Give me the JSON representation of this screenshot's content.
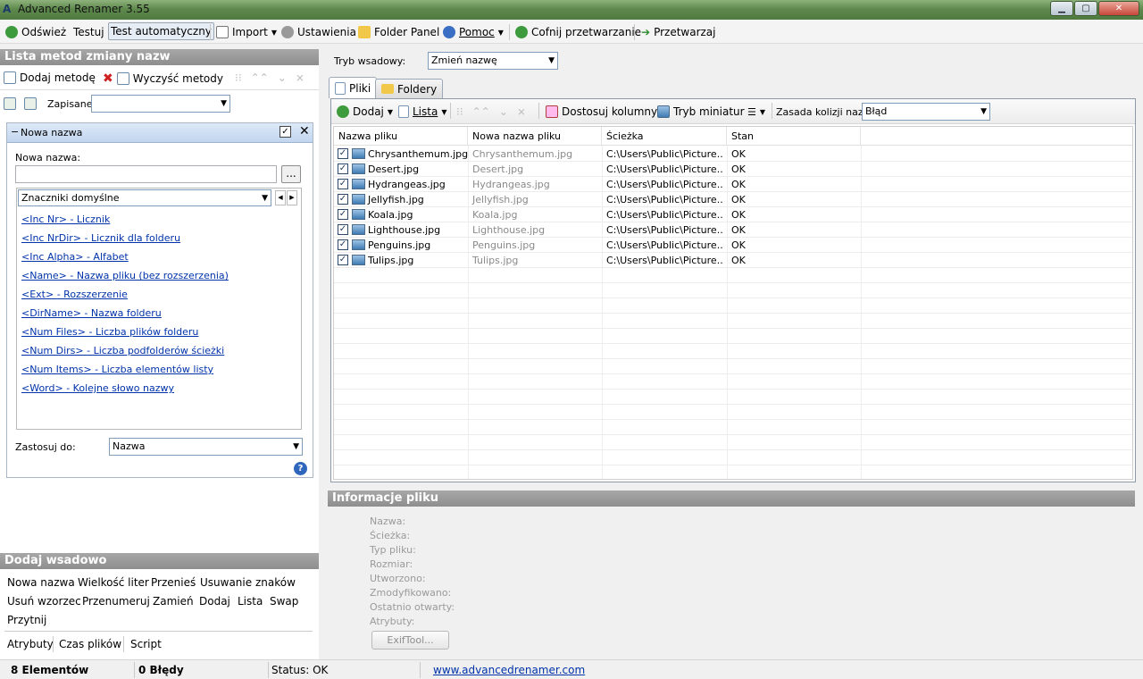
{
  "window": {
    "title": "Advanced Renamer 3.55"
  },
  "toolbar": {
    "refresh": "Odśwież",
    "test": "Testuj",
    "auto_test": "Test automatyczny",
    "import": "Import",
    "settings": "Ustawienia",
    "folder_panel": "Folder Panel",
    "help": "Pomoc",
    "undo": "Cofnij przetwarzanie",
    "process": "Przetwarzaj"
  },
  "left": {
    "header": "Lista metod zmiany nazw",
    "add_method": "Dodaj metodę",
    "clear_methods": "Wyczyść metody",
    "saved_label": "Zapisane:",
    "saved_value": "",
    "method": {
      "title": "Nowa nazwa",
      "field_label": "Nowa nazwa:",
      "field_value": "",
      "browse": "...",
      "tags_select": "Znaczniki domyślne",
      "tags": [
        "<Inc Nr> - Licznik",
        "<Inc NrDir> - Licznik dla folderu",
        "<Inc Alpha> - Alfabet",
        "<Name> - Nazwa pliku (bez rozszerzenia)",
        "<Ext> - Rozszerzenie",
        "<DirName> - Nazwa folderu",
        "<Num Files> - Liczba plików folderu",
        "<Num Dirs> - Liczba podfolderów ścieżki",
        "<Num Items> - Liczba elementów listy",
        "<Word> - Kolejne słowo nazwy"
      ],
      "apply_label": "Zastosuj do:",
      "apply_value": "Nazwa"
    },
    "batch": {
      "header": "Dodaj wsadowo",
      "row1": [
        "Nowa nazwa",
        "Wielkość liter",
        "Przenieś",
        "Usuwanie znaków"
      ],
      "row2": [
        "Usuń wzorzec",
        "Przenumeruj",
        "Zamień",
        "Dodaj",
        "Lista",
        "Swap"
      ],
      "row3": [
        "Przytnij"
      ],
      "row4": [
        "Atrybuty",
        "Czas plików",
        "Script"
      ]
    }
  },
  "right": {
    "mode_label": "Tryb wsadowy:",
    "mode_value": "Zmień nazwę",
    "tabs": [
      "Pliki",
      "Foldery"
    ],
    "list_toolbar": {
      "add": "Dodaj",
      "list": "Lista",
      "fit_columns": "Dostosuj kolumny",
      "thumb_mode": "Tryb miniatur",
      "collision_label": "Zasada kolizji nazw:",
      "collision_value": "Błąd"
    },
    "columns": [
      "Nazwa pliku",
      "Nowa nazwa pliku",
      "Ścieżka",
      "Stan"
    ],
    "files": [
      {
        "name": "Chrysanthemum.jpg",
        "new": "Chrysanthemum.jpg",
        "path": "C:\\Users\\Public\\Picture...",
        "state": "OK"
      },
      {
        "name": "Desert.jpg",
        "new": "Desert.jpg",
        "path": "C:\\Users\\Public\\Picture...",
        "state": "OK"
      },
      {
        "name": "Hydrangeas.jpg",
        "new": "Hydrangeas.jpg",
        "path": "C:\\Users\\Public\\Picture...",
        "state": "OK"
      },
      {
        "name": "Jellyfish.jpg",
        "new": "Jellyfish.jpg",
        "path": "C:\\Users\\Public\\Picture...",
        "state": "OK"
      },
      {
        "name": "Koala.jpg",
        "new": "Koala.jpg",
        "path": "C:\\Users\\Public\\Picture...",
        "state": "OK"
      },
      {
        "name": "Lighthouse.jpg",
        "new": "Lighthouse.jpg",
        "path": "C:\\Users\\Public\\Picture...",
        "state": "OK"
      },
      {
        "name": "Penguins.jpg",
        "new": "Penguins.jpg",
        "path": "C:\\Users\\Public\\Picture...",
        "state": "OK"
      },
      {
        "name": "Tulips.jpg",
        "new": "Tulips.jpg",
        "path": "C:\\Users\\Public\\Picture...",
        "state": "OK"
      }
    ],
    "info": {
      "header": "Informacje pliku",
      "fields": [
        "Nazwa:",
        "Ścieżka:",
        "Typ pliku:",
        "Rozmiar:",
        "Utworzono:",
        "Zmodyfikowano:",
        "Ostatnio otwarty:",
        "Atrybuty:"
      ],
      "exif_button": "ExifTool..."
    }
  },
  "status": {
    "items": "8 Elementów",
    "errors": "0 Błędy",
    "status": "Status: OK",
    "link": "www.advancedrenamer.com"
  },
  "colors": {
    "accent": "#5f8a4e",
    "link": "#0033aa",
    "header_gray": "#9a9a9a"
  }
}
